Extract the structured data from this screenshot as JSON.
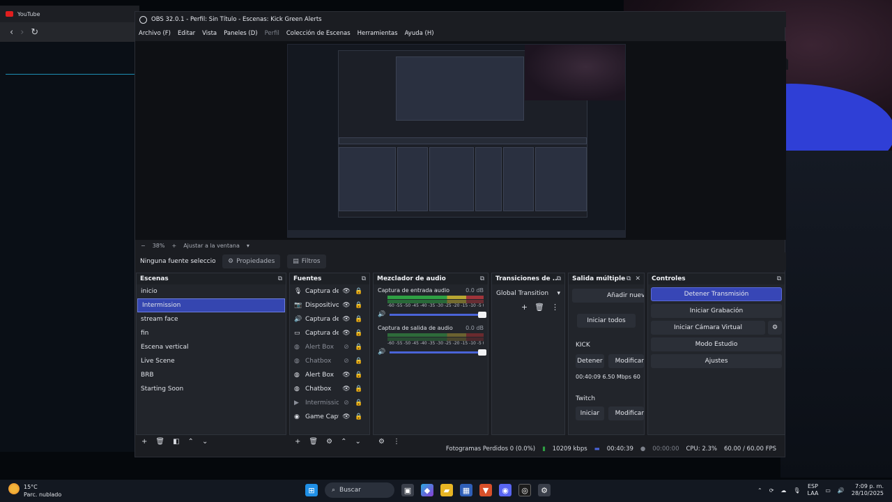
{
  "browser": {
    "tab_title": "YouTube"
  },
  "obs": {
    "title": "OBS 32.0.1 - Perfil: Sin Título - Escenas: Kick Green Alerts",
    "menu": [
      "Archivo (F)",
      "Editar",
      "Vista",
      "Paneles (D)",
      "Perfil",
      "Colección de Escenas",
      "Herramientas",
      "Ayuda (H)"
    ],
    "zoom": {
      "minus": "−",
      "value": "38%",
      "plus": "+",
      "fit": "Ajustar a la ventana"
    },
    "source_toolbar": {
      "no_source": "Ninguna fuente seleccionada",
      "properties": "Propiedades",
      "filters": "Filtros"
    },
    "scenes": {
      "title": "Escenas",
      "items": [
        "inicio",
        "Intermission",
        "stream face",
        "fin",
        "Escena vertical",
        "Live Scene",
        "BRB",
        "Starting Soon"
      ],
      "selected": "Intermission"
    },
    "sources": {
      "title": "Fuentes",
      "items": [
        {
          "icon": "microphone-icon",
          "label": "Captura de entrada de audio",
          "visible": true
        },
        {
          "icon": "camera-icon",
          "label": "Dispositivo de captura",
          "visible": true
        },
        {
          "icon": "speaker-icon",
          "label": "Captura de salida de audio",
          "visible": true
        },
        {
          "icon": "monitor-icon",
          "label": "Captura de pantalla",
          "visible": true
        },
        {
          "icon": "globe-icon",
          "label": "Alert Box",
          "visible": false
        },
        {
          "icon": "globe-icon",
          "label": "Chatbox",
          "visible": false
        },
        {
          "icon": "globe-icon",
          "label": "Alert Box",
          "visible": true
        },
        {
          "icon": "globe-icon",
          "label": "Chatbox",
          "visible": true
        },
        {
          "icon": "play-icon",
          "label": "Intermission",
          "visible": false
        },
        {
          "icon": "gamepad-icon",
          "label": "Game Capture",
          "visible": true
        }
      ]
    },
    "mixer": {
      "title": "Mezclador de audio",
      "tracks": [
        {
          "name": "Captura de entrada audio",
          "db": "0.0 dB",
          "level": 0.62
        },
        {
          "name": "Captura de salida de audio",
          "db": "0.0 dB",
          "level": 0.2
        }
      ],
      "scale": "-60 -55 -50 -45 -40 -35 -30 -25 -20 -15 -10 -5 0"
    },
    "transitions": {
      "title": "Transiciones de ...",
      "selected": "Global Transition"
    },
    "multi_output": {
      "title": "Salida múltiple",
      "add_target": "Añadir nuevo destino",
      "start_all": "Iniciar todos",
      "kick": {
        "label": "KICK",
        "stop": "Detener",
        "modify": "Modificar",
        "stats": "00:40:09  6.50 Mbps  60"
      },
      "twitch": {
        "label": "Twitch",
        "start": "Iniciar",
        "modify": "Modificar"
      }
    },
    "controls": {
      "title": "Controles",
      "stop_stream": "Detener Transmisión",
      "start_record": "Iniciar Grabación",
      "virtual_cam": "Iniciar Cámara Virtual",
      "studio_mode": "Modo Estudio",
      "settings": "Ajustes"
    },
    "status": {
      "frames_dropped": "Fotogramas Perdidos 0 (0.0%)",
      "bitrate": "10209 kbps",
      "live_time": "00:40:39",
      "rec_time": "00:00:00",
      "cpu": "CPU: 2.3%",
      "fps": "60.00 / 60.00 FPS"
    }
  },
  "taskbar": {
    "temperature": "15°C",
    "weather": "Parc. nublado",
    "search": "Buscar",
    "lang": "ESP",
    "layout": "LAA",
    "time": "7:09 p. m.",
    "date": "28/10/2025"
  },
  "colors": {
    "accent": "#3746b6",
    "meter_green": "#2ea043",
    "meter_yellow": "#b8a632",
    "meter_red": "#a0343a"
  }
}
